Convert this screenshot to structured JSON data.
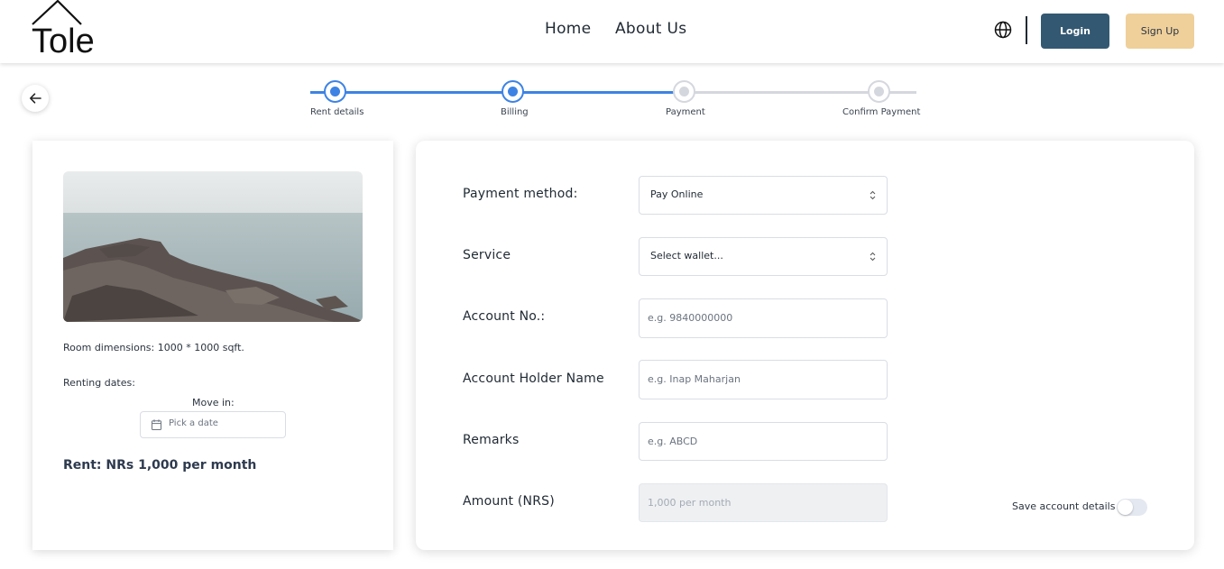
{
  "header": {
    "logo_text": "Tole",
    "nav": {
      "home": "Home",
      "about": "About Us"
    },
    "login_label": "Login",
    "signup_label": "Sign Up"
  },
  "icons": {
    "language": "globe-icon",
    "back": "arrow-left-icon",
    "calendar": "calendar-icon",
    "select": "chevron-up-down-icon"
  },
  "colors": {
    "primary": "#335872",
    "accent": "#efd09b",
    "progress": "#3d83e4",
    "inactive": "#d5d7de"
  },
  "stepper": {
    "steps": [
      {
        "label": "Rent details",
        "status": "complete"
      },
      {
        "label": "Billing",
        "status": "complete"
      },
      {
        "label": "Payment",
        "status": "pending"
      },
      {
        "label": "Confirm Payment",
        "status": "pending"
      }
    ]
  },
  "listing": {
    "dimensions": "Room dimensions: 1000 * 1000 sqft.",
    "renting_dates_label": "Renting dates:",
    "move_in_label": "Move in:",
    "date_placeholder": "Pick a date",
    "rent": "Rent: NRs 1,000 per month"
  },
  "form": {
    "payment_method": {
      "label": "Payment method:",
      "value": "Pay Online"
    },
    "service": {
      "label": "Service",
      "value": "Select wallet..."
    },
    "account_no": {
      "label": "Account No.:",
      "placeholder": "e.g. 9840000000"
    },
    "holder_name": {
      "label": "Account Holder Name",
      "placeholder": "e.g. Inap Maharjan"
    },
    "remarks": {
      "label": "Remarks",
      "placeholder": "e.g. ABCD"
    },
    "amount": {
      "label": "Amount (NRS)",
      "value": "1,000 per month"
    },
    "save_details": {
      "label": "Save account details",
      "checked": false
    }
  }
}
